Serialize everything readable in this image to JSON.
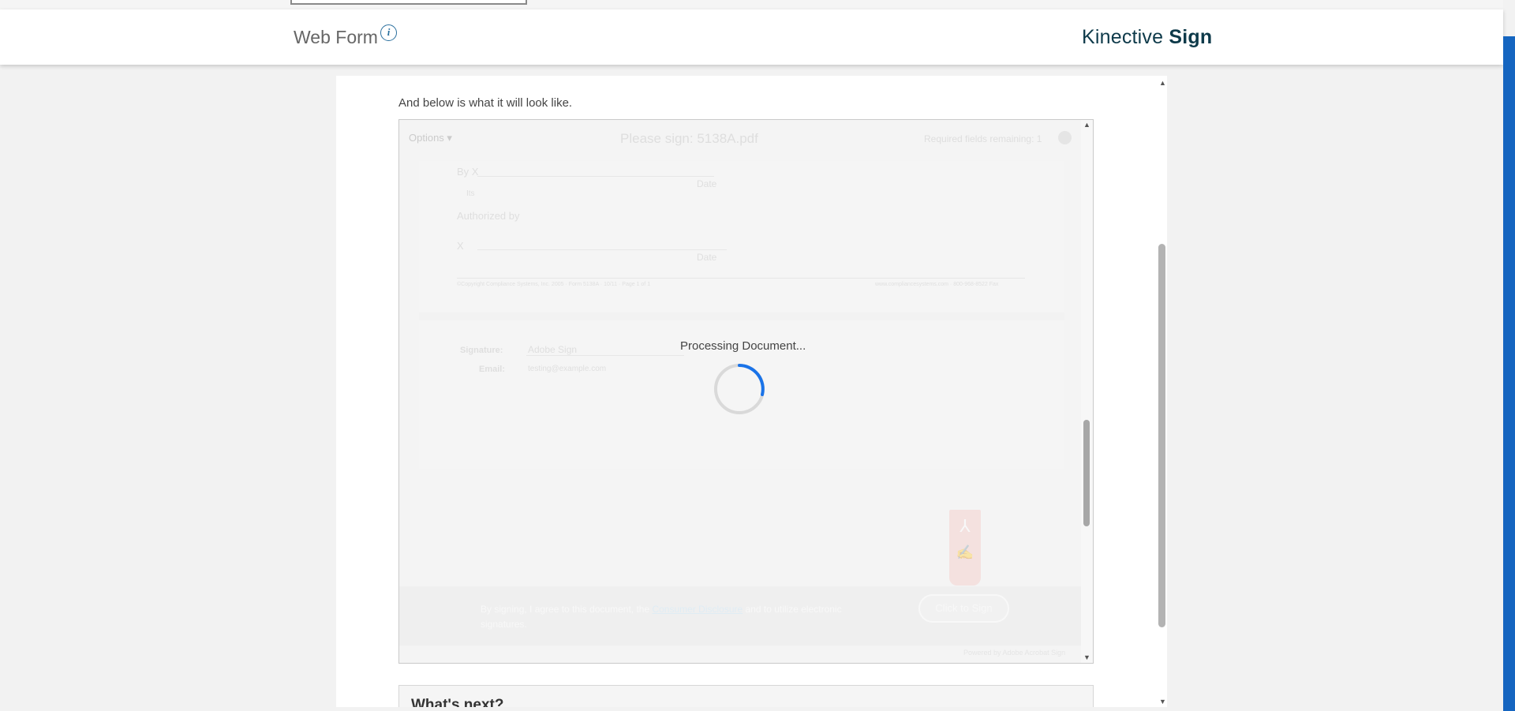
{
  "header": {
    "title": "Web Form",
    "info_icon": "info-icon",
    "brand_light": "Kinective",
    "brand_bold": "Sign"
  },
  "main": {
    "intro": "And below is what it will look like."
  },
  "preview": {
    "options_label": "Options ▾",
    "doc_title": "Please sign: 5138A.pdf",
    "required_fields": "Required fields remaining: 1",
    "by_label": "By X",
    "date_label_1": "Date",
    "its_label": "Its",
    "authorized_label": "Authorized by",
    "x_label": "X",
    "date_label_2": "Date",
    "footer_left": "©Copyright Compliance Systems, Inc. 2005 · Form 5138A · 10/11 · Page 1 of 1",
    "footer_right": "www.compliancesystems.com · 800-968-8522 Fax",
    "signature_label": "Signature:",
    "signature_value": "Adobe Sign",
    "email_label": "Email:",
    "email_value": "testing@example.com",
    "agree_text_1": "By signing, I agree to this document, the",
    "agree_link": "Consumer Disclosure",
    "agree_text_2": "and to utilize electronic signatures.",
    "click_to_sign": "Click to Sign",
    "powered_by": "Powered by Adobe Acrobat Sign"
  },
  "overlay": {
    "processing": "Processing Document..."
  },
  "next": {
    "heading": "What's next?"
  },
  "colors": {
    "accent": "#1565c0",
    "brand": "#0e3a4a",
    "spinner": "#1a73e8"
  }
}
